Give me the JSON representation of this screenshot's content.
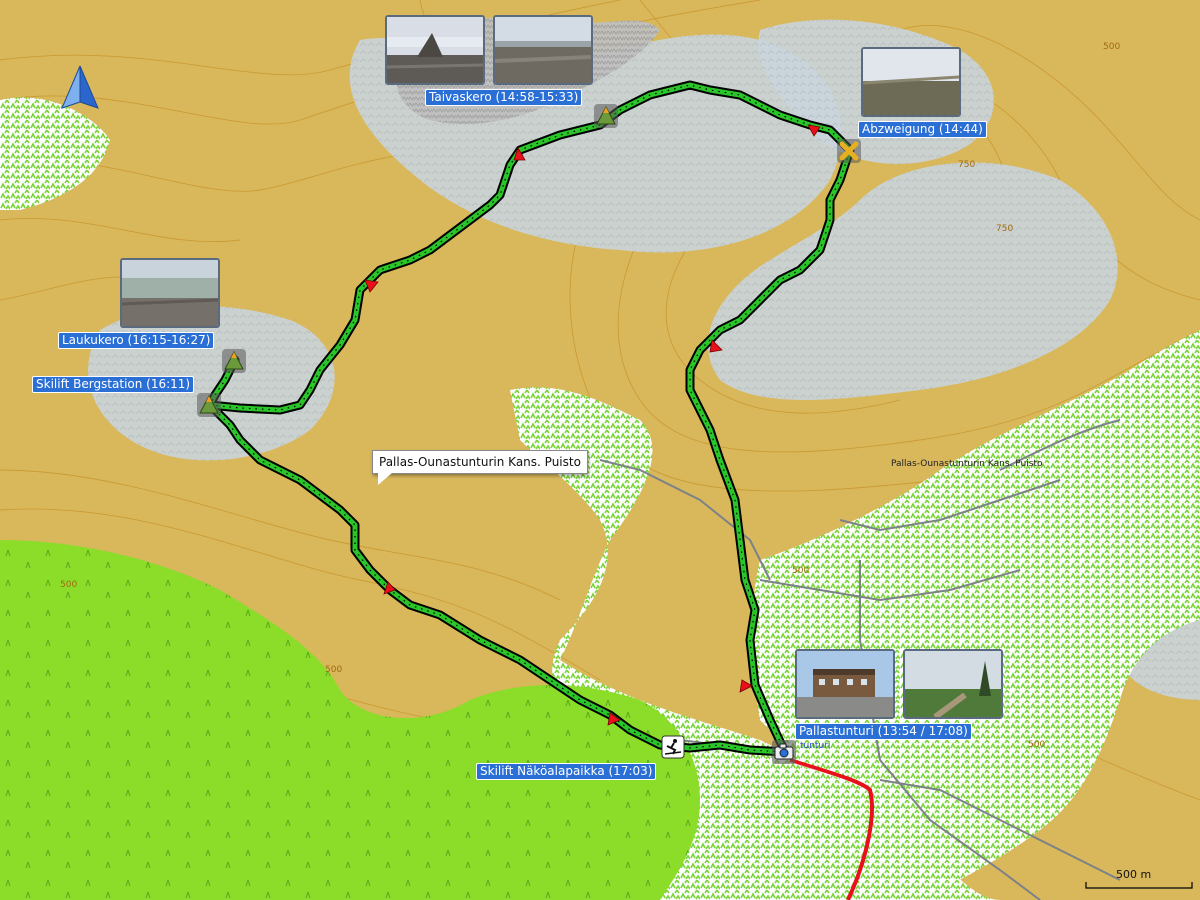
{
  "colors": {
    "terrain": "#d9b85c",
    "rock": "#c9d4dc",
    "forest": "#9fe07a",
    "meadow": "#8cdc2a",
    "track_fill": "#29c529",
    "track_outline": "#000000",
    "road": "#e8101a",
    "label_bg": "#2a6fd6"
  },
  "icons": {
    "north": "north-arrow-icon",
    "summit": "summit-icon",
    "junction": "crossroads-icon",
    "ski": "skier-icon",
    "camera": "camera-icon"
  },
  "waypoints": [
    {
      "id": "taivaskero",
      "label": "Taivaskero (14:58-15:33)",
      "icon": "summit-icon"
    },
    {
      "id": "abzweigung",
      "label": "Abzweigung (14:44)",
      "icon": "crossroads-icon"
    },
    {
      "id": "laukukero",
      "label": "Laukukero (16:15-16:27)",
      "icon": "summit-icon"
    },
    {
      "id": "bergstation",
      "label": "Skilift Bergstation (16:11)",
      "icon": "summit-icon"
    },
    {
      "id": "nakoala",
      "label": "Skilift Näköalapaikka (17:03)",
      "icon": "skier-icon"
    },
    {
      "id": "pallas",
      "label": "Pallastunturi (13:54 / 17:08)",
      "icon": "camera-icon"
    }
  ],
  "tooltip": {
    "text": "Pallas-Ounastunturin Kans. Puisto"
  },
  "map_labels": {
    "park": "Pallas-Ounastunturin Kans. Puisto",
    "tunturi": "tunturi",
    "c500a": "500",
    "c500b": "500",
    "c500c": "500",
    "c500d": "500",
    "c500e": "500",
    "c750": "750",
    "c750b": "750"
  },
  "scale": {
    "label": "500 m"
  }
}
